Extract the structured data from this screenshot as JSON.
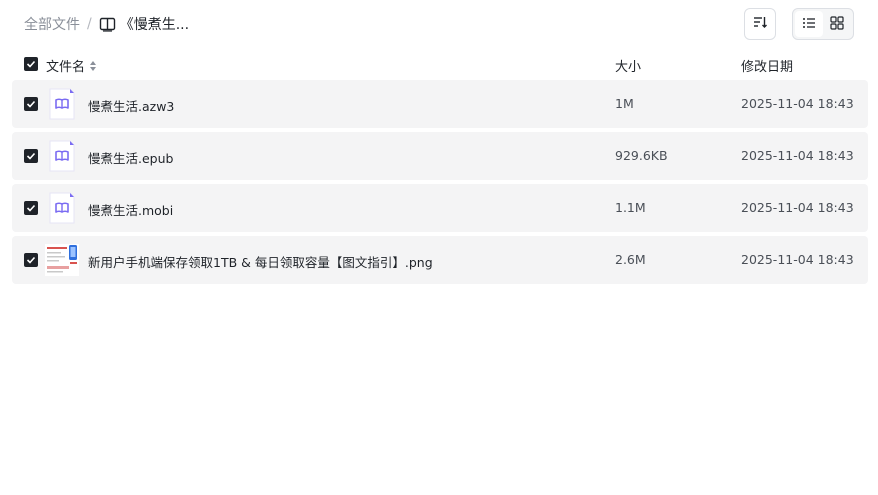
{
  "breadcrumb": {
    "root": "全部文件",
    "separator": "/",
    "current": "《慢煮生..."
  },
  "toolbar": {
    "sort_icon": "sort-list-icon",
    "view_list_icon": "list-view-icon",
    "view_grid_icon": "grid-view-icon",
    "active_view": "list"
  },
  "columns": {
    "name": "文件名",
    "size": "大小",
    "date": "修改日期"
  },
  "files": [
    {
      "name": "慢煮生活.azw3",
      "size": "1M",
      "date": "2025-11-04 18:43",
      "icon": "ebook-icon",
      "checked": true
    },
    {
      "name": "慢煮生活.epub",
      "size": "929.6KB",
      "date": "2025-11-04 18:43",
      "icon": "ebook-icon",
      "checked": true
    },
    {
      "name": "慢煮生活.mobi",
      "size": "1.1M",
      "date": "2025-11-04 18:43",
      "icon": "ebook-icon",
      "checked": true
    },
    {
      "name": "新用户手机端保存领取1TB & 每日领取容量【图文指引】.png",
      "size": "2.6M",
      "date": "2025-11-04 18:43",
      "icon": "image-thumbnail",
      "checked": true
    }
  ],
  "colors": {
    "accent_purple": "#7b6cf2",
    "row_bg": "#f4f4f5",
    "checkbox": "#1f2329"
  }
}
